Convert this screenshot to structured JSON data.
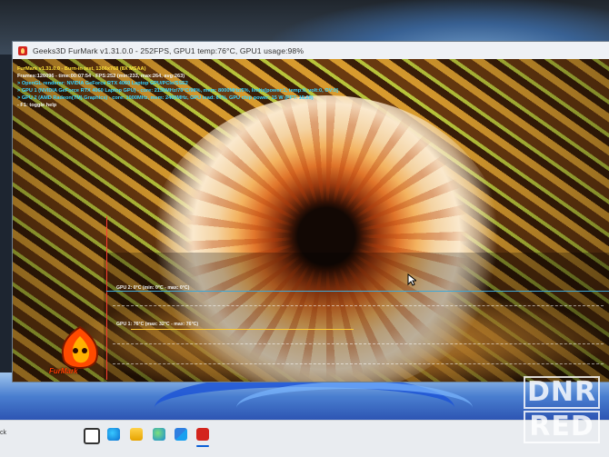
{
  "window": {
    "title": "Geeks3D FurMark v1.31.0.0 - 252FPS, GPU1 temp:76°C, GPU1 usage:98%"
  },
  "osd": {
    "line1": "FurMark v1.31.0.0 - Burn-in test, 1366x768 (8X MSAA)",
    "line2": "Frames:126096 - time:00:07:54 - FPS:252 (min:233, max:264, avg:263)",
    "line3": "> OpenGL renderer: NVIDIA GeForce RTX 4060 Laptop GPU/PCIe/SSE2",
    "line4": "> GPU 1 (NVIDIA GeForce RTX 4060 Laptop GPU) - core: 2130MHz/76°C/98%, mem: 8000MHz/5%, limits[power:1, temp:0, volt:0, OV:0]",
    "line5": "> GPU 2 (AMD Radeon(TM) Graphics) - core: 1000MHz, mem: 2400MHz, GPU load: 67%, GPU chip power: 15 W (PPT: 15.29)",
    "line6": "- F1: toggle help"
  },
  "graph": {
    "gpu2_label": "GPU 2: 0°C (min: 0°C - max: 0°C)",
    "gpu1_label": "GPU 1: 76°C (max: 32°C - max: 76°C)"
  },
  "logo": {
    "text": "FurMark"
  },
  "taskbar": {
    "left_text": "ck",
    "icons": [
      "task-view-icon",
      "edge-icon",
      "file-explorer-icon",
      "edge-dev-icon",
      "store-icon",
      "furmark-icon"
    ]
  },
  "watermark": {
    "line1": "DNR",
    "line2": "RED"
  },
  "colors": {
    "osd_yellow": "#ffe23b",
    "osd_cyan": "#38d3ff",
    "graph_axis": "#ff3b30",
    "gpu2_line": "#3fa7d6",
    "gpu1_line": "#ffcc33"
  }
}
